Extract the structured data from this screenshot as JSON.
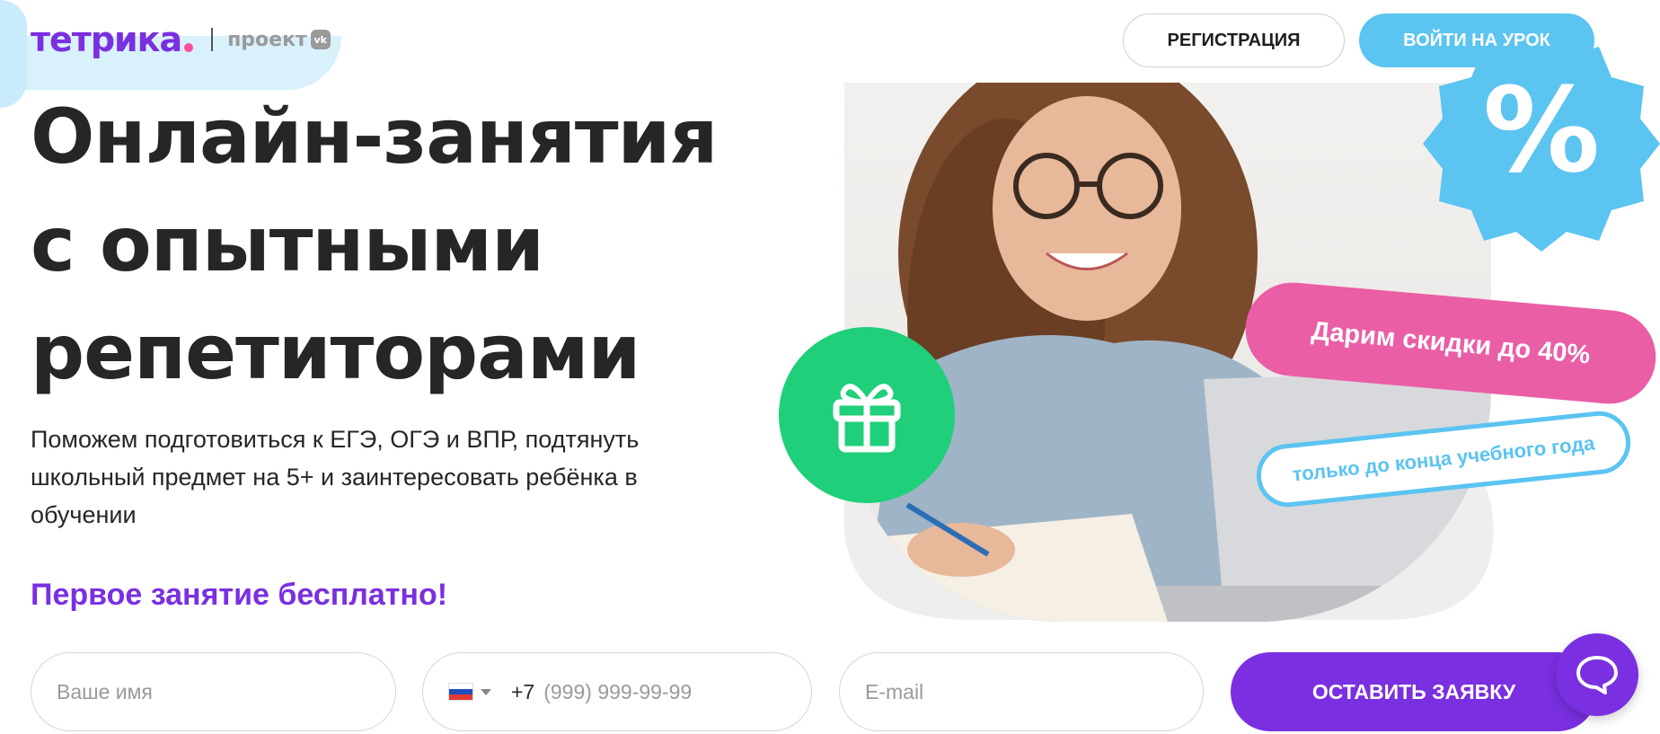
{
  "header": {
    "logo_text": "тетрика",
    "project_label": "проект",
    "vk_label": "vk",
    "register_button": "РЕГИСТРАЦИЯ",
    "login_button": "ВОЙТИ НА УРОК"
  },
  "hero": {
    "headline_lines": [
      "Онлайн-занятия",
      "с опытными",
      "репетиторами"
    ],
    "subtext": "Поможем подготовиться к ЕГЭ, ОГЭ и ВПР, подтянуть школьный предмет на 5+ и заинтересовать ребёнка в обучении",
    "free_lesson": "Первое занятие бесплатно!",
    "discount_badge": "Дарим скидки до 40%",
    "deadline_badge": "только до конца учебного года",
    "seal_symbol": "%"
  },
  "form": {
    "name_placeholder": "Ваше имя",
    "phone_code": "+7",
    "phone_placeholder": "(999) 999-99-99",
    "email_placeholder": "E-mail",
    "submit_button": "ОСТАВИТЬ ЗАЯВКУ"
  },
  "icons": {
    "gift": "gift-icon",
    "chat": "chat-icon",
    "flag": "russia-flag-icon",
    "caret": "chevron-down-icon"
  },
  "colors": {
    "brand_purple": "#7a2fe0",
    "accent_blue": "#5bc4f1",
    "accent_pink": "#ea5ea6",
    "gift_green": "#1fcf7a"
  }
}
